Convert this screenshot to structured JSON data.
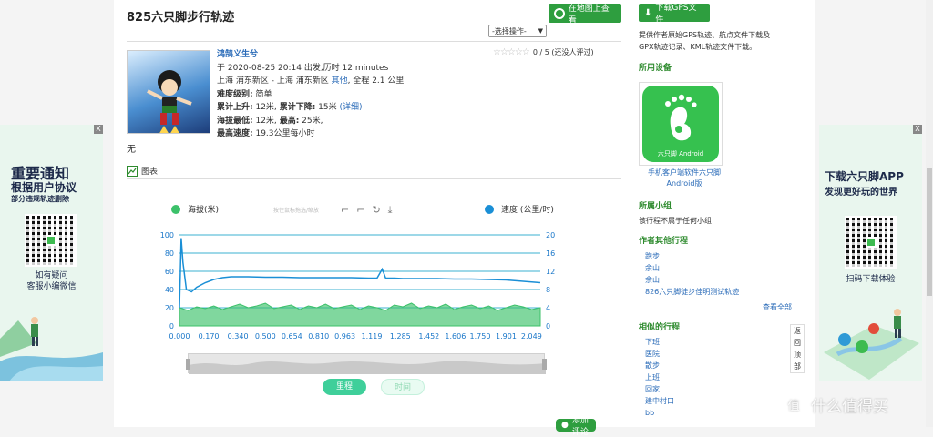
{
  "track": {
    "title": "825六只脚步行轨迹",
    "map_button": "在地图上查看",
    "select_value": "-选择操作-",
    "rating_text": "0 / 5 (还没人评过)",
    "author": "鸿鹄义生兮",
    "depart": "于 2020-08-25 20:14 出发,历时 12 minutes",
    "route_prefix": "上海  浦东新区 - 上海  浦东新区",
    "route_other": "其他",
    "route_total": "全程 2.1 公里",
    "difficulty_label": "难度级别:",
    "difficulty_value": "简单",
    "rise_label": "累计上升:",
    "rise_value": "12米,",
    "fall_label": "累计下降:",
    "fall_value": "15米",
    "detail_link": "(详细)",
    "min_alt_label": "海拔最低:",
    "min_alt_value": "12米,",
    "max_alt_label": "最高:",
    "max_alt_value": "25米,",
    "max_speed_label": "最高速度:",
    "max_speed_value": "19.3公里每小时",
    "desc": "无",
    "chart_tab": "图表",
    "bottom_button": "添加评论"
  },
  "chart_data": {
    "type": "line",
    "legend_left": "海拔(米)",
    "legend_right": "速度 (公里/时)",
    "watermark": "按住鼠标拖选/缩放",
    "x_ticks": [
      "0.000",
      "0.170",
      "0.340",
      "0.500",
      "0.654",
      "0.810",
      "0.963",
      "1.119",
      "1.285",
      "1.452",
      "1.606",
      "1.750",
      "1.901",
      "2.049"
    ],
    "y_left_ticks": [
      "100",
      "80",
      "60",
      "40",
      "20",
      "0"
    ],
    "y_right_ticks": [
      "20",
      "16",
      "12",
      "8",
      "4",
      "0"
    ],
    "ylim_left": [
      0,
      100
    ],
    "ylim_right": [
      0,
      20
    ],
    "xlim": [
      0,
      2.1
    ],
    "series": [
      {
        "name": "海拔(米)",
        "axis": "left",
        "color": "#3cc16a",
        "x": [
          0,
          0.05,
          0.1,
          0.15,
          0.2,
          0.25,
          0.3,
          0.35,
          0.4,
          0.45,
          0.5,
          0.55,
          0.6,
          0.65,
          0.7,
          0.75,
          0.8,
          0.85,
          0.9,
          0.95,
          1.0,
          1.05,
          1.1,
          1.15,
          1.2,
          1.25,
          1.3,
          1.35,
          1.4,
          1.45,
          1.5,
          1.55,
          1.6,
          1.65,
          1.7,
          1.75,
          1.8,
          1.85,
          1.9,
          1.95,
          2.0,
          2.05,
          2.1
        ],
        "values": [
          20,
          17,
          21,
          19,
          22,
          18,
          21,
          24,
          20,
          22,
          25,
          19,
          21,
          23,
          18,
          22,
          20,
          24,
          19,
          21,
          23,
          18,
          22,
          20,
          17,
          23,
          21,
          25,
          19,
          22,
          20,
          24,
          18,
          21,
          23,
          19,
          22,
          17,
          20,
          23,
          21,
          18,
          20
        ]
      },
      {
        "name": "速度 (公里/时)",
        "axis": "right",
        "color": "#1a8fd6",
        "x": [
          0,
          0.01,
          0.02,
          0.04,
          0.07,
          0.1,
          0.15,
          0.2,
          0.25,
          0.3,
          0.4,
          0.5,
          0.6,
          0.7,
          0.8,
          0.9,
          1.0,
          1.1,
          1.15,
          1.18,
          1.2,
          1.22,
          1.25,
          1.3,
          1.4,
          1.5,
          1.6,
          1.7,
          1.8,
          1.9,
          2.0,
          2.1
        ],
        "values": [
          4,
          19.3,
          14,
          8,
          7.5,
          8.5,
          9.5,
          10.2,
          10.6,
          10.8,
          10.8,
          10.7,
          10.7,
          10.6,
          10.6,
          10.6,
          10.6,
          10.5,
          10.5,
          12.5,
          10.5,
          10.5,
          10.5,
          10.4,
          10.4,
          10.4,
          10.3,
          10.3,
          10.2,
          10.1,
          9.8,
          9.5
        ]
      }
    ],
    "range_buttons": [
      "里程",
      "时间"
    ]
  },
  "sidebar": {
    "download_button": "下载GPS文件",
    "desc_line1": "提供作者原始GPS轨迹、航点文件下载及",
    "desc_line2": "GPX轨迹记录、KML轨迹文件下载。",
    "device_title": "所用设备",
    "device_app_label": "六只脚 Android",
    "device_caption1": "手机客户端软件六只脚",
    "device_caption2": "Android版",
    "group_title": "所属小组",
    "group_text": "该行程不属于任何小组",
    "author_trips_title": "作者其他行程",
    "author_trips": [
      "跑步",
      "余山",
      "余山",
      "826六只脚徒步佳明测试轨迹"
    ],
    "see_all": "查看全部",
    "similar_title": "相似的行程",
    "similar": [
      "下班",
      "医院",
      "散步",
      "上班",
      "回家",
      "建中村口",
      "bb"
    ],
    "back_top": [
      "返",
      "回",
      "顶",
      "部"
    ]
  },
  "ad_left": {
    "close": "X",
    "heading1": "重要通知",
    "heading2": "根据用户协议",
    "heading3": "部分违规轨迹删除",
    "qr_caption1": "如有疑问",
    "qr_caption2": "客服小编微信"
  },
  "ad_right": {
    "close": "X",
    "heading1": "下载六只脚APP",
    "heading2": "发现更好玩的世界",
    "qr_caption": "扫码下载体验"
  },
  "watermark": {
    "badge": "值",
    "text": "什么值得买"
  }
}
